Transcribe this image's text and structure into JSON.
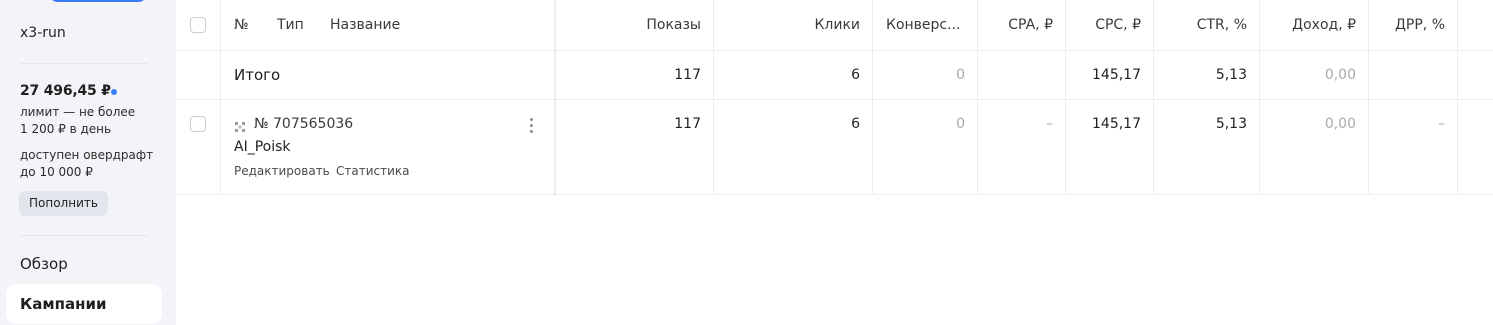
{
  "sidebar": {
    "account_name": "x3-run",
    "balance": "27 496,45 ₽",
    "limit_text": "лимит — не более 1 200 ₽ в день",
    "overdraft_text": "доступен овердрафт до 10 000 ₽",
    "topup_label": "Пополнить",
    "nav": [
      {
        "label": "Обзор",
        "active": false
      },
      {
        "label": "Кампании",
        "active": true
      }
    ],
    "accent_color": "#3d7bfd"
  },
  "table": {
    "headers": {
      "num": "№",
      "type": "Тип",
      "name": "Название",
      "impressions": "Показы",
      "clicks": "Клики",
      "conversions": "Конверс...",
      "cpa": "CPA, ₽",
      "cpc": "CPC, ₽",
      "ctr": "CTR, %",
      "revenue": "Доход, ₽",
      "drr": "ДРР, %"
    },
    "total": {
      "label": "Итого",
      "impressions": "117",
      "clicks": "6",
      "conversions": "0",
      "cpa": "",
      "cpc": "145,17",
      "ctr": "5,13",
      "revenue": "0,00",
      "drr": ""
    },
    "campaigns": [
      {
        "id": "№ 707565036",
        "type_icon": "campaign-type-icon",
        "name": "AI_Poisk",
        "edit_label": "Редактировать",
        "stats_label": "Статистика",
        "impressions": "117",
        "clicks": "6",
        "conversions": "0",
        "cpa": "–",
        "cpc": "145,17",
        "ctr": "5,13",
        "revenue": "0,00",
        "drr": "–"
      }
    ]
  }
}
